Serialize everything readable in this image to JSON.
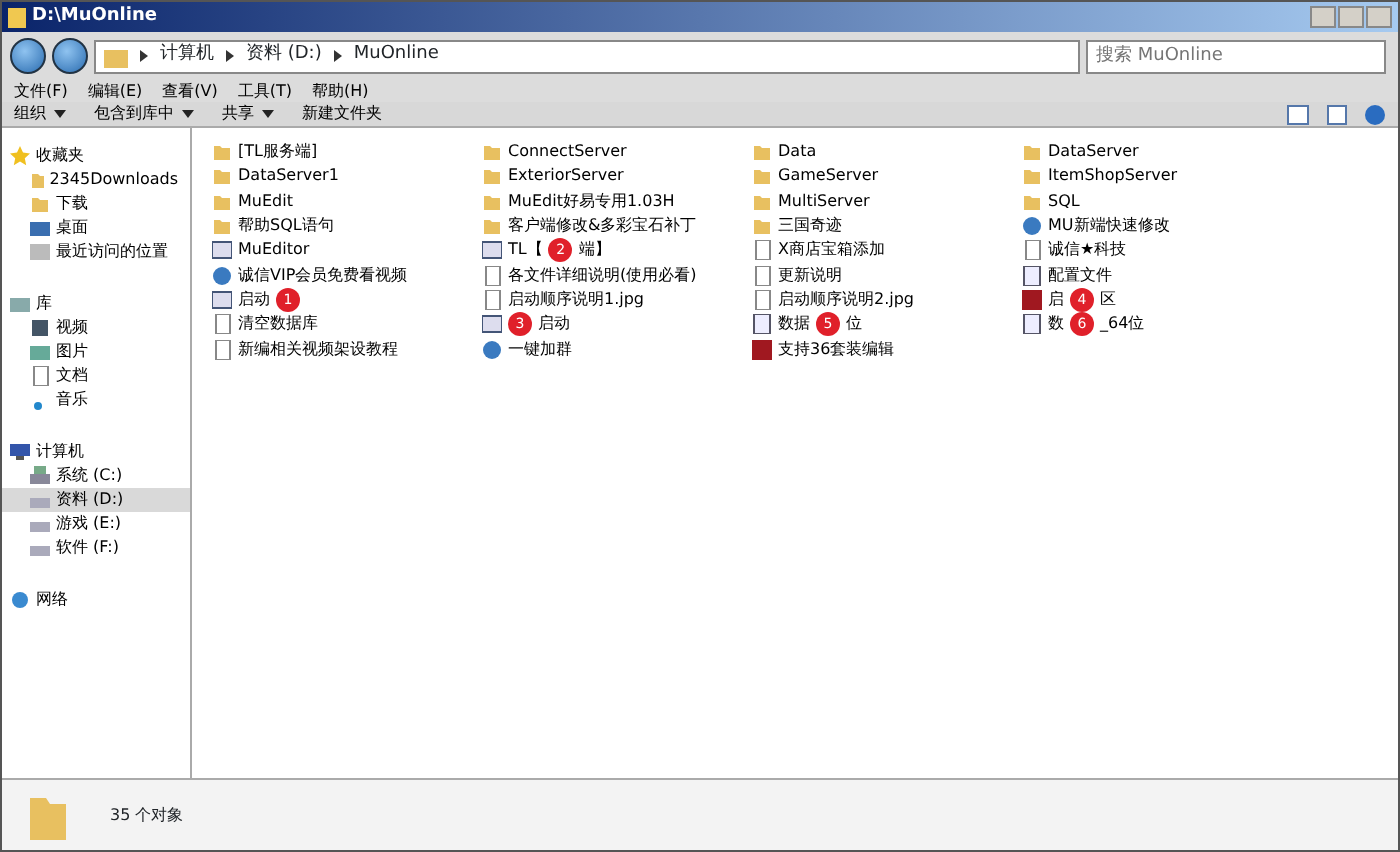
{
  "window": {
    "title": "D:\\MuOnline"
  },
  "address": {
    "crumbs": [
      "计算机",
      "资料 (D:)",
      "MuOnline"
    ]
  },
  "search": {
    "placeholder": "搜索 MuOnline"
  },
  "menu": [
    "文件(F)",
    "编辑(E)",
    "查看(V)",
    "工具(T)",
    "帮助(H)"
  ],
  "toolbar": [
    {
      "label": "组织",
      "dropdown": true
    },
    {
      "label": "包含到库中",
      "dropdown": true
    },
    {
      "label": "共享",
      "dropdown": true
    },
    {
      "label": "新建文件夹",
      "dropdown": false
    }
  ],
  "sidebar": [
    {
      "label": "收藏夹",
      "kind": "star",
      "children": [
        {
          "label": "2345Downloads",
          "kind": "folder",
          "selected": false
        },
        {
          "label": "下载",
          "kind": "folder",
          "selected": false
        },
        {
          "label": "桌面",
          "kind": "desktop",
          "selected": false
        },
        {
          "label": "最近访问的位置",
          "kind": "recent",
          "selected": false
        }
      ]
    },
    {
      "label": "库",
      "kind": "library",
      "children": [
        {
          "label": "视频",
          "kind": "video",
          "selected": false
        },
        {
          "label": "图片",
          "kind": "picture",
          "selected": false
        },
        {
          "label": "文档",
          "kind": "doc",
          "selected": false
        },
        {
          "label": "音乐",
          "kind": "music",
          "selected": false
        }
      ]
    },
    {
      "label": "计算机",
      "kind": "computer",
      "children": [
        {
          "label": "系统 (C:)",
          "kind": "sysdrive",
          "selected": false
        },
        {
          "label": "资料 (D:)",
          "kind": "drive",
          "selected": true
        },
        {
          "label": "游戏 (E:)",
          "kind": "drive",
          "selected": false
        },
        {
          "label": "软件 (F:)",
          "kind": "drive",
          "selected": false
        }
      ]
    },
    {
      "label": "网络",
      "kind": "network"
    }
  ],
  "files": [
    [
      {
        "name": "[TL服务端]",
        "kind": "folder"
      },
      {
        "name": "DataServer1",
        "kind": "folder"
      },
      {
        "name": "MuEdit",
        "kind": "folder"
      },
      {
        "name": "帮助SQL语句",
        "kind": "folder"
      },
      {
        "name": "MuEditor",
        "kind": "exe"
      },
      {
        "name": "诚信VIP会员免费看视频",
        "kind": "web"
      },
      {
        "name": "启动",
        "kind": "exe",
        "badge": "1"
      },
      {
        "name": "清空数据库",
        "kind": "doc"
      },
      {
        "name": "新编相关视频架设教程",
        "kind": "doc"
      }
    ],
    [
      {
        "name": "ConnectServer",
        "kind": "folder"
      },
      {
        "name": "ExteriorServer",
        "kind": "folder"
      },
      {
        "name": "MuEdit好易专用1.03H",
        "kind": "folder"
      },
      {
        "name": "客户端修改&多彩宝石补丁",
        "kind": "folder"
      },
      {
        "name": "TL【",
        "kind": "exe",
        "badge": "2",
        "rest": "端】"
      },
      {
        "name": "各文件详细说明(使用必看)",
        "kind": "doc"
      },
      {
        "name": "启动顺序说明1.jpg",
        "kind": "doc"
      },
      {
        "kind": "exe",
        "badge": "3",
        "rest": "启动"
      },
      {
        "name": "一键加群",
        "kind": "web"
      }
    ],
    [
      {
        "name": "Data",
        "kind": "folder"
      },
      {
        "name": "GameServer",
        "kind": "folder"
      },
      {
        "name": "MultiServer",
        "kind": "folder"
      },
      {
        "name": "三国奇迹",
        "kind": "folder"
      },
      {
        "name": "X商店宝箱添加",
        "kind": "doc"
      },
      {
        "name": "更新说明",
        "kind": "doc"
      },
      {
        "name": "启动顺序说明2.jpg",
        "kind": "doc"
      },
      {
        "name": "数据",
        "kind": "ini",
        "badge": "5",
        "rest": "位"
      },
      {
        "name": "支持36套装编辑",
        "kind": "red"
      }
    ],
    [
      {
        "name": "DataServer",
        "kind": "folder"
      },
      {
        "name": "ItemShopServer",
        "kind": "folder"
      },
      {
        "name": "SQL",
        "kind": "folder"
      },
      {
        "name": "MU新端快速修改",
        "kind": "web"
      },
      {
        "name": "诚信★科技",
        "kind": "doc"
      },
      {
        "name": "配置文件",
        "kind": "ini"
      },
      {
        "name": "启",
        "kind": "red",
        "badge": "4",
        "rest": "区"
      },
      {
        "name": "数",
        "kind": "ini",
        "badge": "6",
        "rest": "_64位"
      }
    ]
  ],
  "status_bar": {
    "text": "35 个对象"
  }
}
